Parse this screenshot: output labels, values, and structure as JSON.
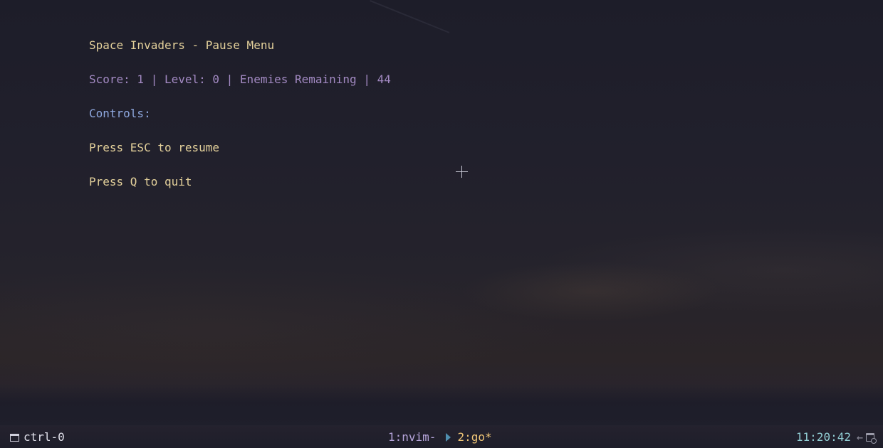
{
  "menu": {
    "title": "Space Invaders - Pause Menu",
    "stats": "Score: 1 | Level: 0 | Enemies Remaining | 44",
    "controls_heading": "Controls:",
    "resume_hint": "Press ESC to resume",
    "quit_hint": "Press Q to quit"
  },
  "statusbar": {
    "session_icon": "window-icon",
    "session": "ctrl-0",
    "windows": [
      {
        "label": "1:nvim-"
      },
      {
        "label": "2:go*"
      }
    ],
    "clock": "11:20:42",
    "right_icons": [
      "arrow-left-icon",
      "calendar-clock-icon"
    ]
  },
  "colors": {
    "title": "#e4d19b",
    "stats": "#a38ac3",
    "controls": "#8fa8df",
    "active_window": "#f0c677",
    "inactive_window": "#b7a6dc",
    "clock": "#93d0d6"
  }
}
